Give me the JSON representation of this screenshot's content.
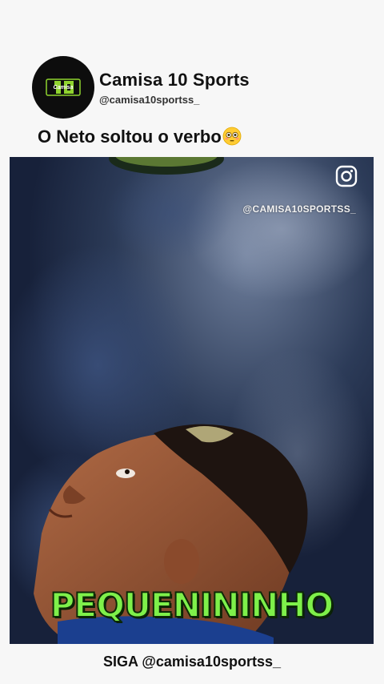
{
  "post": {
    "account_name": "Camisa 10 Sports",
    "account_handle": "@camisa10sportss_",
    "logo_text": "Camisa",
    "caption": "O Neto soltou o verbo",
    "caption_emoji": "flushed-face-emoji"
  },
  "video": {
    "platform_icon": "instagram-icon",
    "watermark_handle": "@CAMISA10SPORTSS_",
    "overlay_text": "PEQUENININHO",
    "overlay_color": "#7ef04a"
  },
  "footer": {
    "cta": "SIGA @camisa10sportss_"
  },
  "colors": {
    "background": "#f7f7f7",
    "avatar_bg": "#0d0d0d",
    "brand_green": "#8fd32f"
  }
}
